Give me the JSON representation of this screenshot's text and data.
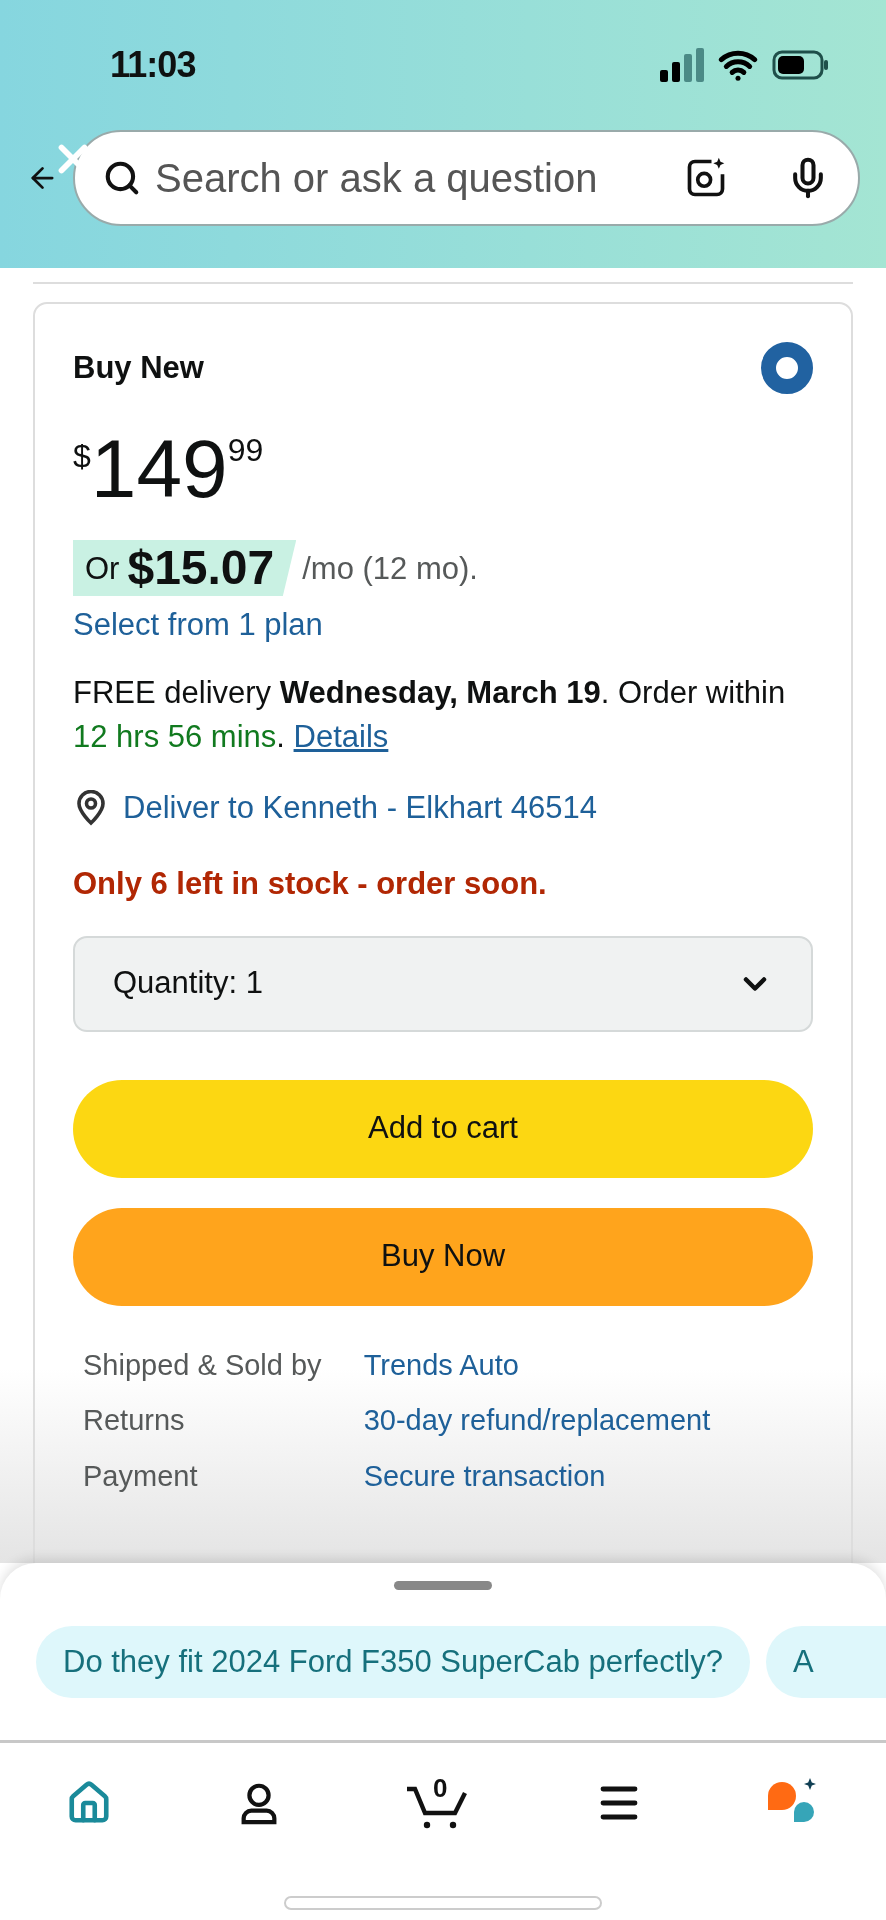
{
  "status_bar": {
    "time": "11:03"
  },
  "search": {
    "placeholder": "Search or ask a question"
  },
  "offer": {
    "title": "Buy New",
    "selected": true,
    "price": {
      "symbol": "$",
      "whole": "149",
      "fraction": "99"
    },
    "financing": {
      "prefix": "Or",
      "amount": "$15.07",
      "term": "/mo (12 mo)."
    },
    "plan_link": "Select from 1 plan",
    "delivery": [
      {
        "kind": "plain",
        "text": "FREE delivery "
      },
      {
        "kind": "bold",
        "text": "Wednesday, March 19"
      },
      {
        "kind": "plain",
        "text": ". Order within "
      },
      {
        "kind": "urgent",
        "text": "12 hrs 56 mins"
      },
      {
        "kind": "plain",
        "text": ". "
      },
      {
        "kind": "link",
        "text": "Details"
      }
    ],
    "deliver_to": "Deliver to Kenneth - Elkhart 46514",
    "stock_message": "Only 6 left in stock - order soon.",
    "quantity": {
      "label": "Quantity:",
      "value": "1"
    },
    "buttons": [
      {
        "kind": "cart",
        "label": "Add to cart"
      },
      {
        "kind": "buy",
        "label": "Buy Now"
      }
    ],
    "details": [
      {
        "label": "Shipped & Sold by",
        "value": "Trends Auto"
      },
      {
        "label": "Returns",
        "value": "30-day refund/replacement"
      },
      {
        "label": "Payment",
        "value": "Secure transaction"
      }
    ]
  },
  "suggestions": [
    {
      "text": "Do they fit 2024 Ford F350 SuperCab perfectly?"
    },
    {
      "text": "A"
    }
  ],
  "nav": [
    {
      "kind": "home",
      "selected": true
    },
    {
      "kind": "account",
      "selected": false
    },
    {
      "kind": "cart",
      "selected": false,
      "badge": "0"
    },
    {
      "kind": "menu",
      "selected": false
    },
    {
      "kind": "assistant",
      "selected": false
    }
  ]
}
